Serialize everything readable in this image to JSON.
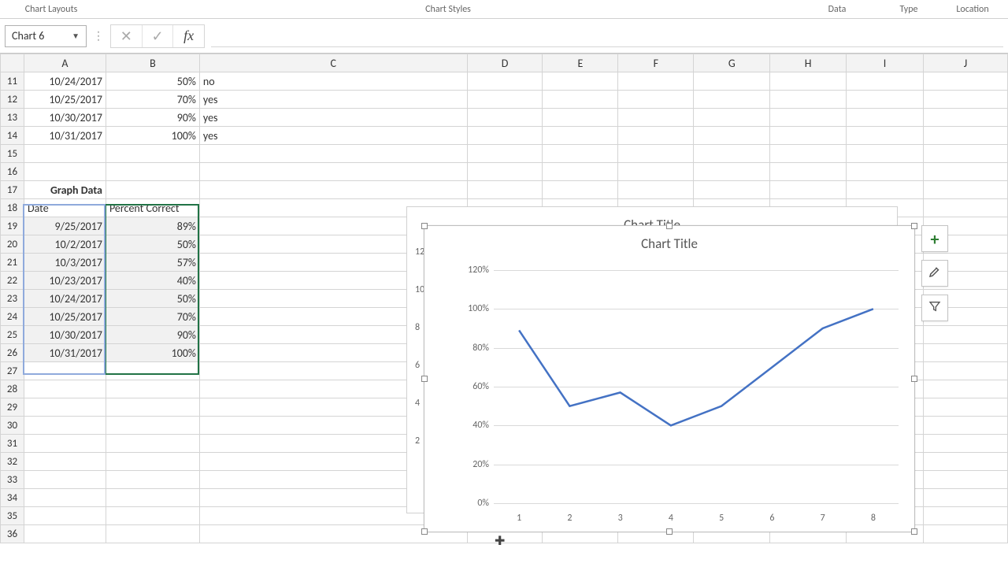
{
  "ribbon": {
    "layouts": "Chart Layouts",
    "styles": "Chart Styles",
    "data": "Data",
    "type": "Type",
    "location": "Location"
  },
  "namebox": {
    "value": "Chart 6"
  },
  "formula_bar": {
    "cancel": "✕",
    "enter": "✓",
    "fx": "fx",
    "value": ""
  },
  "columns": [
    "A",
    "B",
    "C",
    "D",
    "E",
    "F",
    "G",
    "H",
    "I",
    "J"
  ],
  "row_start": 11,
  "row_end": 36,
  "cells": {
    "11": {
      "A": "10/24/2017",
      "B": "50%",
      "C": "no"
    },
    "12": {
      "A": "10/25/2017",
      "B": "70%",
      "C": "yes"
    },
    "13": {
      "A": "10/30/2017",
      "B": "90%",
      "C": "yes"
    },
    "14": {
      "A": "10/31/2017",
      "B": "100%",
      "C": "yes"
    },
    "17": {
      "A": "Graph Data"
    },
    "18": {
      "A": "Date",
      "B": "Percent Correct"
    },
    "19": {
      "A": "9/25/2017",
      "B": "89%"
    },
    "20": {
      "A": "10/2/2017",
      "B": "50%"
    },
    "21": {
      "A": "10/3/2017",
      "B": "57%"
    },
    "22": {
      "A": "10/23/2017",
      "B": "40%"
    },
    "23": {
      "A": "10/24/2017",
      "B": "50%"
    },
    "24": {
      "A": "10/25/2017",
      "B": "70%"
    },
    "25": {
      "A": "10/30/2017",
      "B": "90%"
    },
    "26": {
      "A": "10/31/2017",
      "B": "100%"
    }
  },
  "selection": {
    "col": "B",
    "rows": [
      18,
      26
    ],
    "also_col": "A",
    "also_rows": [
      18,
      26
    ]
  },
  "chart_back": {
    "title": "Chart Title",
    "y_ticks": [
      "12",
      "10",
      "8",
      "6",
      "4",
      "2"
    ]
  },
  "side_tools": {
    "plus": "+",
    "brush": "✎",
    "filter": "⌖"
  },
  "chart_data": {
    "type": "line",
    "title": "Chart Title",
    "xlabel": "",
    "ylabel": "",
    "y_ticks": [
      "0%",
      "20%",
      "40%",
      "60%",
      "80%",
      "100%",
      "120%"
    ],
    "ylim": [
      0,
      120
    ],
    "categories": [
      "1",
      "2",
      "3",
      "4",
      "5",
      "6",
      "7",
      "8"
    ],
    "values": [
      89,
      50,
      57,
      40,
      50,
      70,
      90,
      100
    ],
    "series_color": "#4472C4"
  }
}
